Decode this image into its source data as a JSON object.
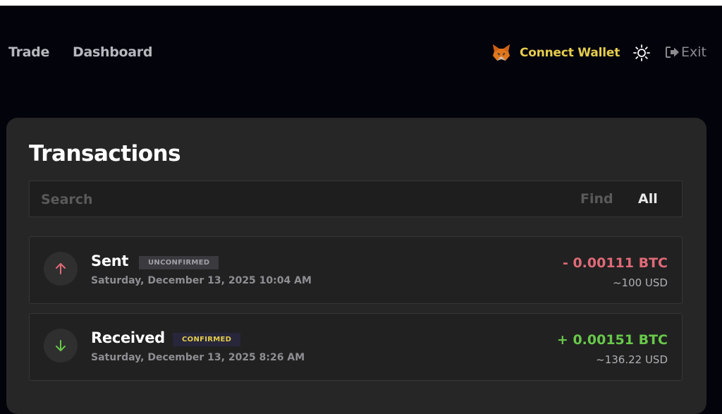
{
  "nav": {
    "trade_label": "Trade",
    "dashboard_label": "Dashboard",
    "connect_wallet_label": "Connect Wallet",
    "exit_label": "Exit",
    "icons": [
      "metamask-fox-icon",
      "sun-icon",
      "exit-icon"
    ]
  },
  "page": {
    "title": "Transactions"
  },
  "search": {
    "placeholder": "Search",
    "value": "",
    "find_label": "Find",
    "all_label": "All"
  },
  "transactions": [
    {
      "type": "Sent",
      "status": "UNCONFIRMED",
      "date": "Saturday, December 13, 2025 10:04 AM",
      "amount": "- 0.00111 BTC",
      "usd": "~100 USD",
      "icon": "arrow-up-icon",
      "color": "#e06a78"
    },
    {
      "type": "Received",
      "status": "CONFIRMED",
      "date": "Saturday, December 13, 2025 8:26 AM",
      "amount": "+ 0.00151 BTC",
      "usd": "~136.22 USD",
      "icon": "arrow-down-icon",
      "color": "#68c94a"
    }
  ],
  "colors": {
    "background": "#03030c",
    "panel": "#262626",
    "accent": "#e5cd4c"
  }
}
